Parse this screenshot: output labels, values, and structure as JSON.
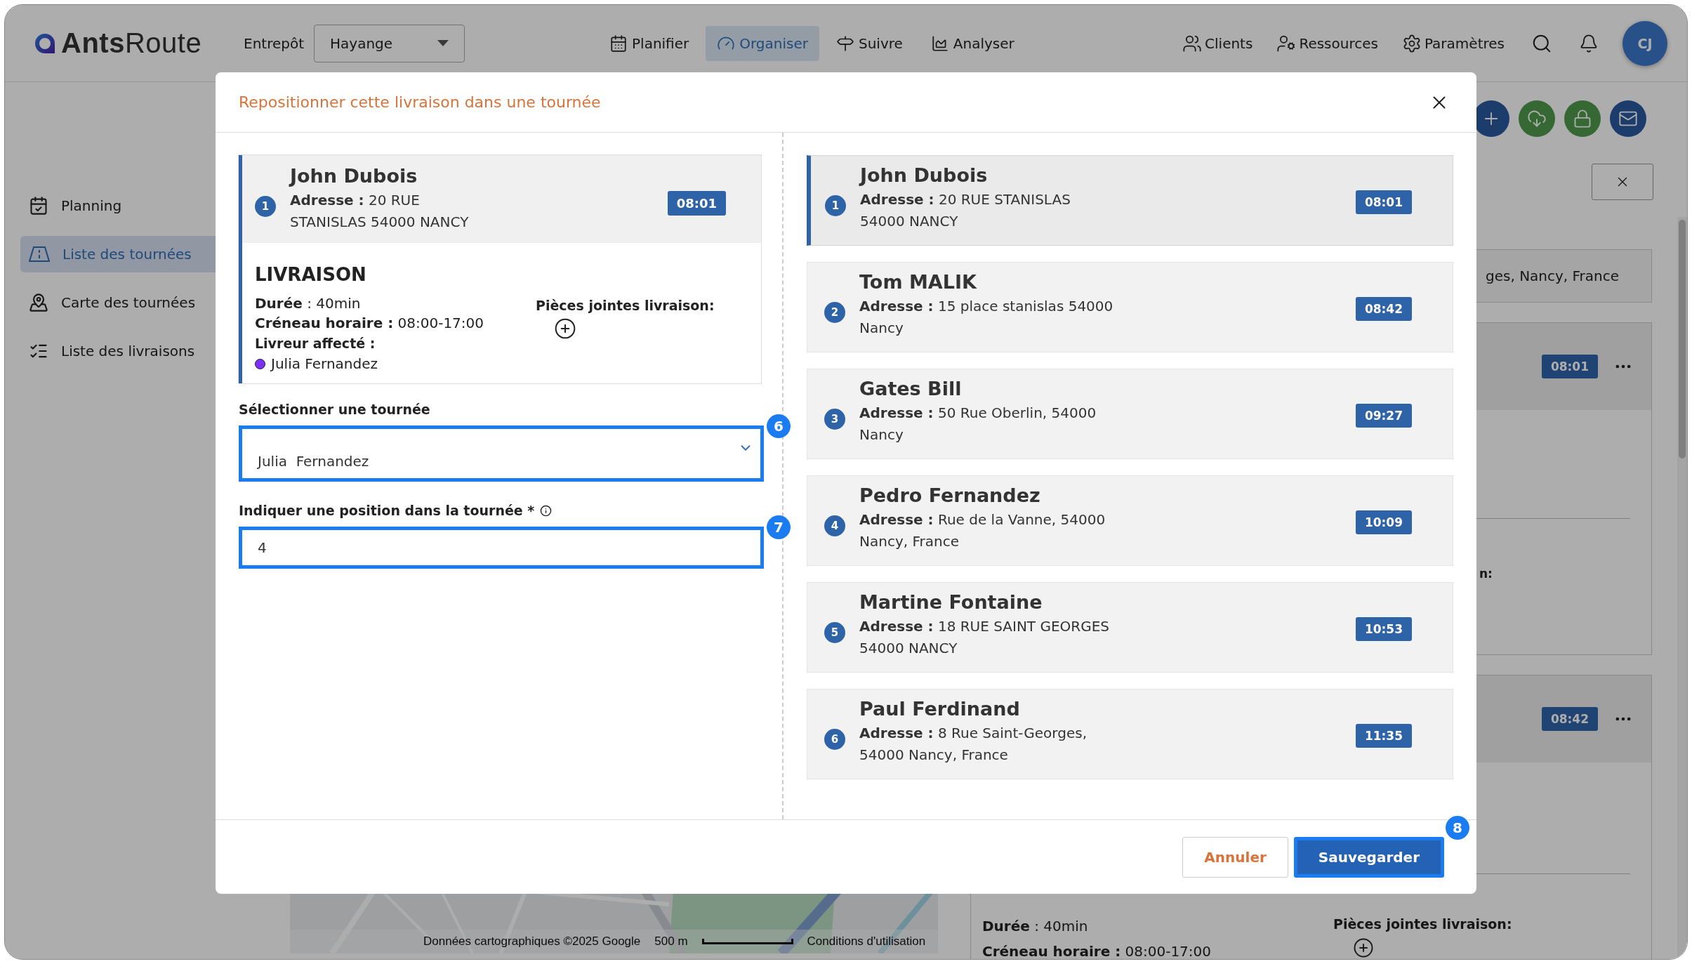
{
  "brand": {
    "strong": "Ants",
    "light": "Route"
  },
  "warehouse": {
    "label": "Entrepôt",
    "value": "Hayange"
  },
  "nav": [
    {
      "label": "Planifier",
      "selected": false
    },
    {
      "label": "Organiser",
      "selected": true
    },
    {
      "label": "Suivre",
      "selected": false
    },
    {
      "label": "Analyser",
      "selected": false
    }
  ],
  "menu": [
    {
      "label": "Clients"
    },
    {
      "label": "Ressources"
    },
    {
      "label": "Paramètres"
    }
  ],
  "user": {
    "initials": "CJ"
  },
  "sidebar": {
    "items": [
      {
        "label": "Planning",
        "selected": false
      },
      {
        "label": "Liste des tournées",
        "selected": true
      },
      {
        "label": "Carte des tournées",
        "selected": false
      },
      {
        "label": "Liste des livraisons",
        "selected": false
      }
    ]
  },
  "actions": [
    {
      "kind": "add"
    },
    {
      "kind": "upload"
    },
    {
      "kind": "lock"
    },
    {
      "kind": "mail"
    }
  ],
  "detail_panel": {
    "address_fragment": "ges, Nancy, France",
    "stops": [
      {
        "time": "08:01",
        "fragment": "n:"
      },
      {
        "time": "08:42"
      }
    ],
    "duration": "**Durée** : 40min",
    "slot": "**Créneau horaire :** 08:00-17:00",
    "attachments_label": "Pièces jointes livraison:"
  },
  "map": {
    "attribution": "Données cartographiques ©2025 Google",
    "scale": "500 m",
    "terms": "Conditions d'utilisation"
  },
  "modal": {
    "title": "Repositionner cette livraison dans une tournée",
    "delivery": {
      "number": "1",
      "name": "John Dubois",
      "address_lines": [
        "**Adresse :** 20 RUE",
        "STANISLAS 54000 NANCY"
      ],
      "time": "08:01",
      "section": "LIVRAISON",
      "duration": "**Durée** : 40min",
      "slot": "**Créneau horaire :** 08:00-17:00",
      "driver_label": "Livreur affecté :",
      "driver": {
        "name": "Julia Fernandez",
        "color": "#7b2ff7"
      },
      "attachments_label": "Pièces jointes livraison:"
    },
    "tour_select": {
      "label": "Sélectionner une tournée",
      "value": "Julia  Fernandez",
      "step": "6"
    },
    "position": {
      "label": "Indiquer une position dans la tournée *",
      "value": "4",
      "step": "7"
    },
    "stops": [
      {
        "number": "1",
        "name": "John Dubois",
        "address_lines": [
          "**Adresse :** 20 RUE STANISLAS",
          "54000 NANCY"
        ],
        "time": "08:01",
        "selected": true
      },
      {
        "number": "2",
        "name": "Tom MALIK",
        "address_lines": [
          "**Adresse :** 15 place stanislas 54000",
          "Nancy"
        ],
        "time": "08:42",
        "selected": false
      },
      {
        "number": "3",
        "name": "Gates Bill",
        "address_lines": [
          "**Adresse :** 50 Rue Oberlin, 54000",
          "Nancy"
        ],
        "time": "09:27",
        "selected": false
      },
      {
        "number": "4",
        "name": "Pedro Fernandez",
        "address_lines": [
          "**Adresse :** Rue de la Vanne, 54000",
          "Nancy, France"
        ],
        "time": "10:09",
        "selected": false
      },
      {
        "number": "5",
        "name": "Martine Fontaine",
        "address_lines": [
          "**Adresse :** 18 RUE SAINT GEORGES",
          "54000 NANCY"
        ],
        "time": "10:53",
        "selected": false
      },
      {
        "number": "6",
        "name": "Paul Ferdinand",
        "address_lines": [
          "**Adresse :** 8 Rue Saint-Georges,",
          "54000 Nancy, France"
        ],
        "time": "11:35",
        "selected": false
      }
    ],
    "buttons": [
      {
        "kind": "cancel",
        "label": "Annuler"
      },
      {
        "kind": "save",
        "label": "Sauvegarder",
        "step": "8"
      }
    ]
  }
}
